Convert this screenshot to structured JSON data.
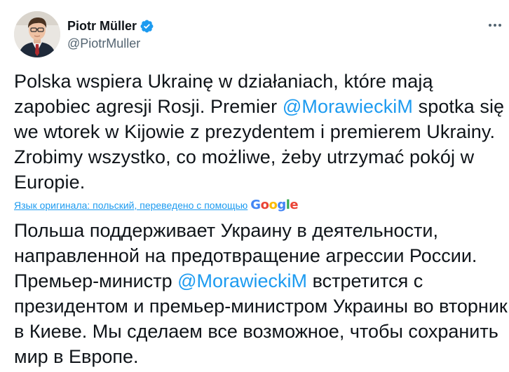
{
  "author": {
    "display_name": "Piotr Müller",
    "handle": "@PiotrMuller",
    "verified_icon": "verified-badge-icon",
    "avatar_icon": "avatar-photo"
  },
  "menu": {
    "icon": "more-options-icon"
  },
  "tweet": {
    "pre_mention": "Polska wspiera Ukrainę w działaniach, które mają zapobiec agresji Rosji. Premier ",
    "mention": "@MorawieckiM",
    "post_mention": " spotka się we wtorek w Kijowie z prezydentem i premierem Ukrainy. Zrobimy wszystko, co możliwe, żeby utrzymać pokój w Europie."
  },
  "translation": {
    "link_text": "Язык оригинала: польский, переведено с помощью",
    "provider_logo": "Google",
    "pre_mention": "Польша поддерживает Украину в деятельности, направленной на предотвращение агрессии России. Премьер-министр ",
    "mention": "@MorawieckiM",
    "post_mention": " встретится с президентом и премьер-министром Украины во вторник в Киеве. Мы сделаем все возможное, чтобы сохранить мир в Европе."
  },
  "colors": {
    "accent": "#1d9bf0",
    "text": "#0f1419",
    "secondary": "#536471"
  }
}
